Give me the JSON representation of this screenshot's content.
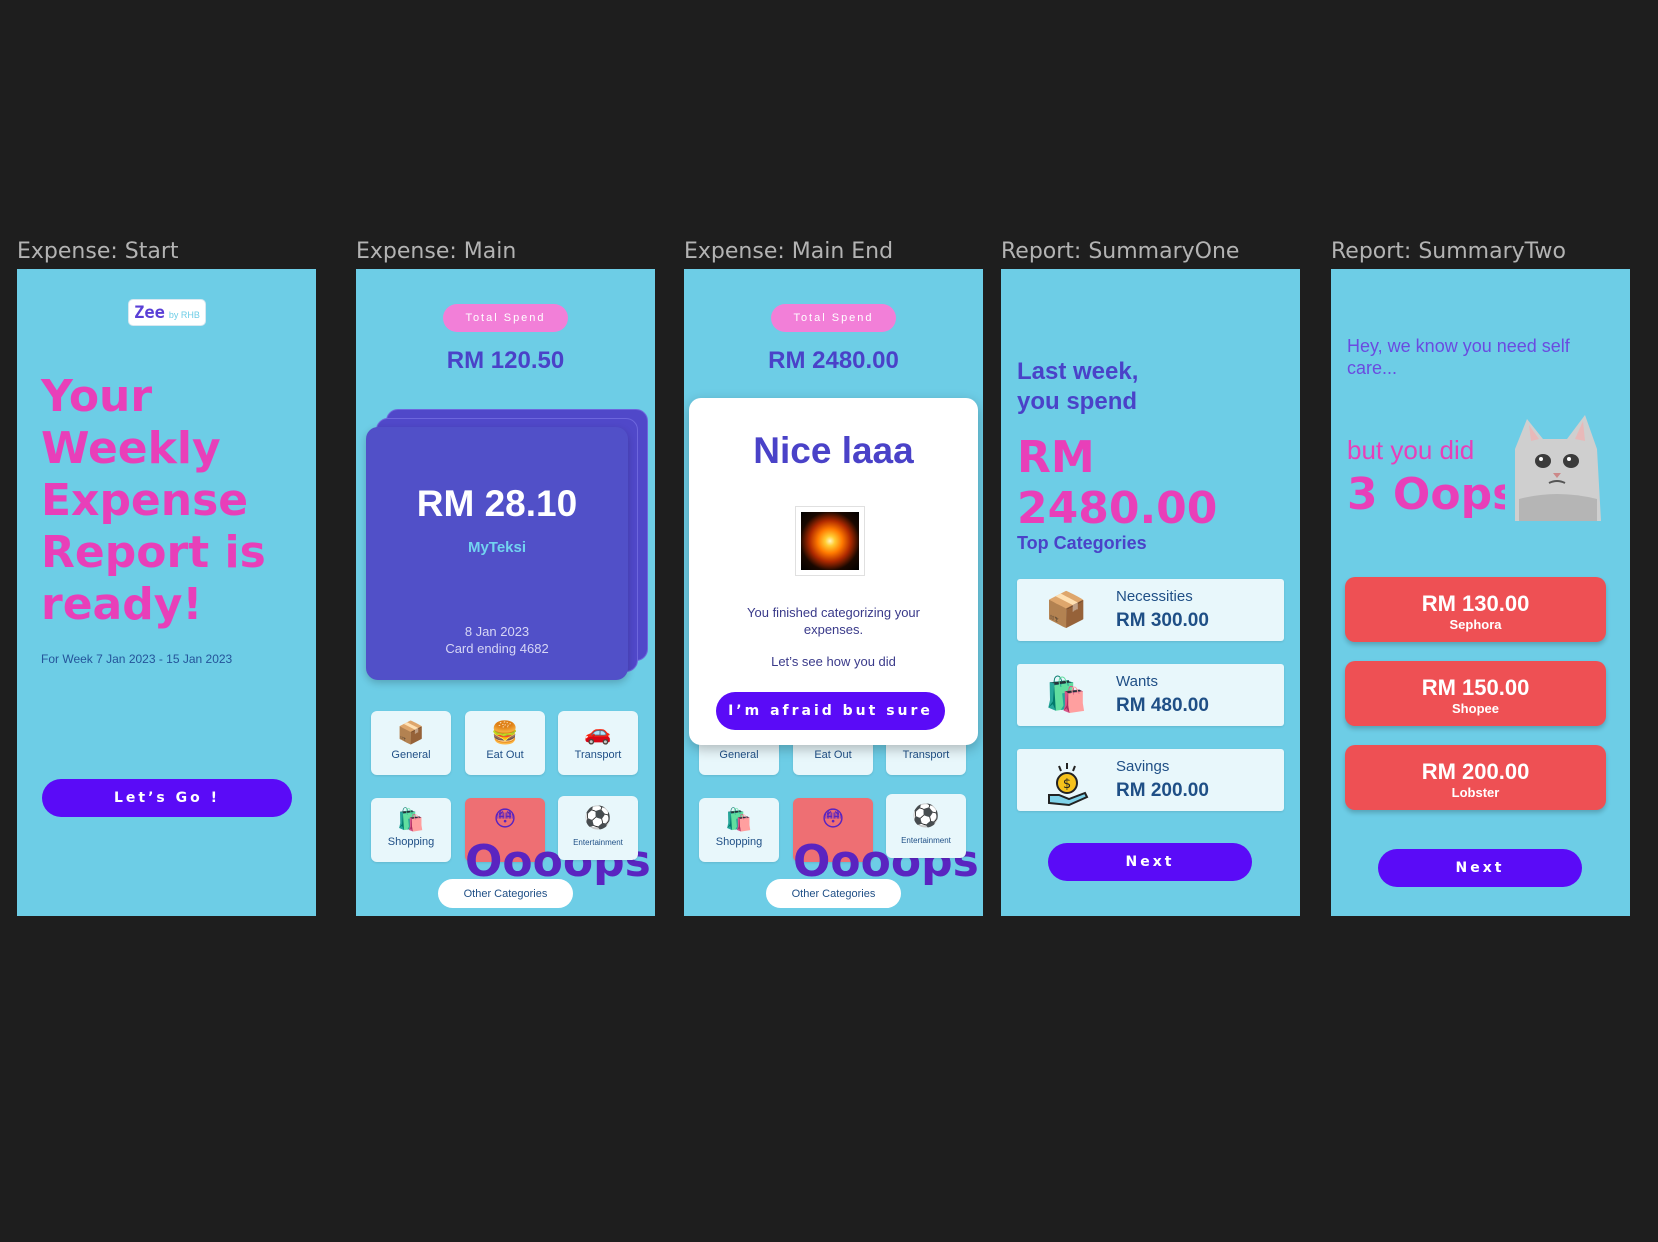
{
  "frames": [
    {
      "label": "Expense: Start"
    },
    {
      "label": "Expense: Main"
    },
    {
      "label": "Expense: Main End"
    },
    {
      "label": "Report: SummaryOne"
    },
    {
      "label": "Report: SummaryTwo"
    }
  ],
  "start": {
    "logo_main": "Zee",
    "logo_sub": "by RHB",
    "headline": "Your Weekly Expense Report is ready!",
    "week": "For Week 7 Jan 2023 - 15 Jan 2023",
    "cta": "Let’s Go !"
  },
  "main": {
    "pill": "Total Spend",
    "total": "RM 120.50",
    "card": {
      "amount": "RM 28.10",
      "merchant": "MyTeksi",
      "date": "8 Jan 2023",
      "card_ending": "Card ending 4682"
    },
    "categories": [
      {
        "label": "General",
        "icon": "box-icon"
      },
      {
        "label": "Eat Out",
        "icon": "burger-icon"
      },
      {
        "label": "Transport",
        "icon": "car-icon"
      },
      {
        "label": "Shopping",
        "icon": "shopping-bags-icon"
      },
      {
        "label": "Oooops",
        "icon": "flushed-face-icon"
      },
      {
        "label": "Entertainment",
        "icon": "soccer-ball-icon"
      }
    ],
    "other": "Other Categories"
  },
  "main_end": {
    "pill": "Total Spend",
    "total": "RM 2480.00",
    "modal": {
      "title": "Nice laaa",
      "msg": "You finished categorizing your expenses.",
      "msg2": "Let’s see how you did",
      "button": "I’m afraid but sure"
    },
    "categories": [
      {
        "label": "General"
      },
      {
        "label": "Eat Out"
      },
      {
        "label": "Transport"
      },
      {
        "label": "Shopping"
      },
      {
        "label": "Oooops"
      },
      {
        "label": "Entertainment"
      }
    ],
    "other": "Other Categories"
  },
  "summary_one": {
    "intro": "Last week, you spend",
    "amount": "RM 2480.00",
    "top_title": "Top Categories",
    "rows": [
      {
        "name": "Necessities",
        "value": "RM 300.00",
        "icon": "box-icon"
      },
      {
        "name": "Wants",
        "value": "RM 480.00",
        "icon": "shopping-bags-icon"
      },
      {
        "name": "Savings",
        "value": "RM 200.00",
        "icon": "money-hand-icon"
      }
    ],
    "next": "Next"
  },
  "summary_two": {
    "hey": "Hey, we know you need self care...",
    "but": "but you did",
    "oops": "3 Oops",
    "items": [
      {
        "amount": "RM 130.00",
        "merchant": "Sephora"
      },
      {
        "amount": "RM 150.00",
        "merchant": "Shopee"
      },
      {
        "amount": "RM 200.00",
        "merchant": "Lobster"
      }
    ],
    "next": "Next"
  },
  "colors": {
    "frame_bg": "#6dcde6",
    "pink": "#e83fb9",
    "purple_btn": "#5a0bf7",
    "indigo": "#4a42c8",
    "oops_red": "#ee5054"
  }
}
